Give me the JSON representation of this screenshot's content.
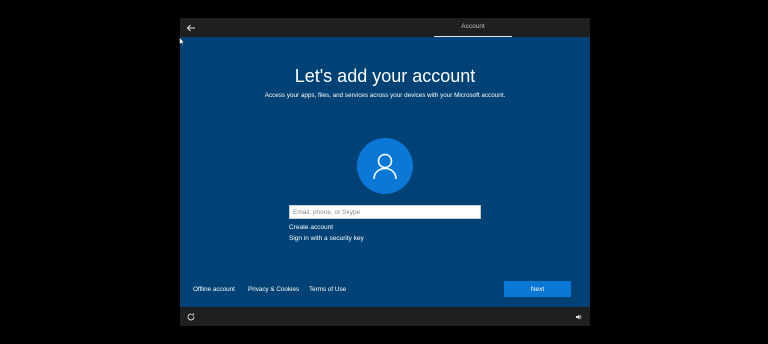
{
  "header": {
    "tab_label": "Account",
    "back_icon": "back-arrow-icon"
  },
  "main": {
    "title": "Let's add your account",
    "subtitle": "Access your apps, files, and services across your devices with your Microsoft account.",
    "avatar_icon": "person-icon",
    "email_placeholder": "Email, phone, or Skype",
    "email_value": "",
    "links": {
      "create_account": "Create account",
      "security_key": "Sign in with a security key"
    }
  },
  "footer": {
    "offline_account": "Offline account",
    "privacy": "Privacy & Cookies",
    "terms": "Terms of Use",
    "next_label": "Next"
  },
  "taskbar": {
    "left_icon": "ease-of-access-icon",
    "right_icon": "volume-icon"
  },
  "colors": {
    "background": "#004275",
    "accent": "#0a78d7",
    "bar": "#1f1f1f"
  }
}
